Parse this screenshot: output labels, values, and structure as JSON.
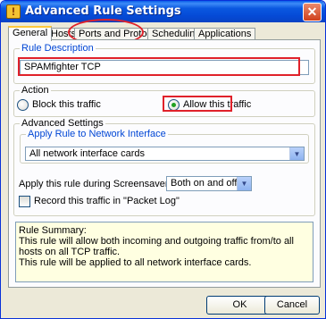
{
  "window": {
    "title": "Advanced Rule Settings",
    "close_glyph": "✕",
    "icon": "rule-settings-icon"
  },
  "tabs": [
    {
      "label": "General"
    },
    {
      "label": "Hosts"
    },
    {
      "label": "Ports and Protocols"
    },
    {
      "label": "Scheduling"
    },
    {
      "label": "Applications"
    }
  ],
  "rule_description": {
    "legend": "Rule Description",
    "value": "SPAMfighter TCP"
  },
  "action": {
    "legend": "Action",
    "block_label": "Block this traffic",
    "allow_label": "Allow this traffic",
    "selected": "allow"
  },
  "advanced": {
    "legend": "Advanced Settings",
    "interface_legend": "Apply Rule to Network Interface",
    "interface_value": "All network interface cards",
    "screensaver_label": "Apply this rule during Screensaver Mode",
    "screensaver_value": "Both on and off",
    "packet_log_label": "Record this traffic in \"Packet Log\"",
    "packet_log_checked": false
  },
  "summary": {
    "title": "Rule Summary:",
    "line1": "This rule will allow both incoming and outgoing traffic from/to all hosts on all TCP traffic.",
    "line2": "This rule will be applied to all network interface cards."
  },
  "buttons": {
    "ok": "OK",
    "cancel": "Cancel"
  },
  "colors": {
    "highlight": "#e0212a",
    "accent": "#0046d5",
    "titlebar": "#0a58e0"
  }
}
